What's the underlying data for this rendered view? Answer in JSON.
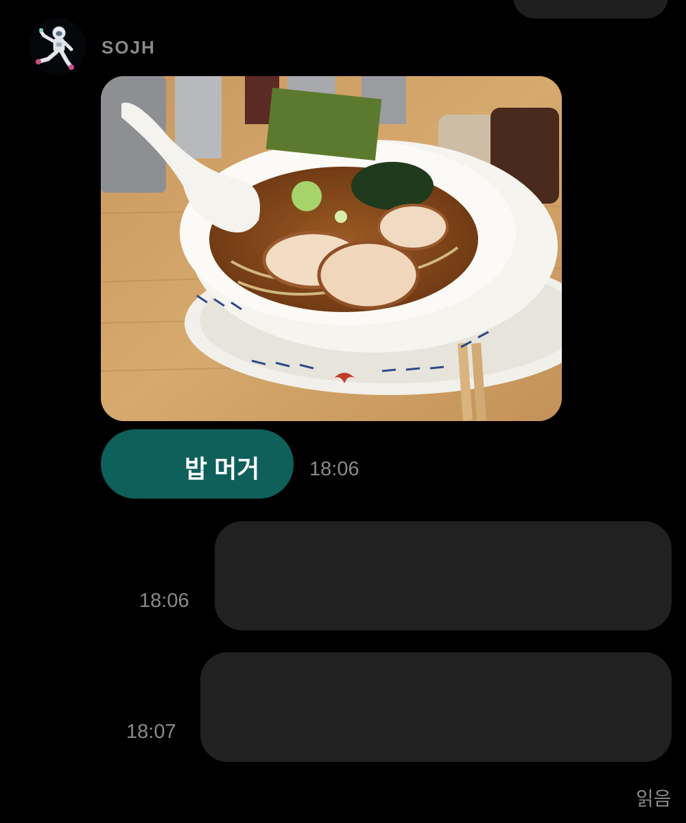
{
  "chat": {
    "sender_name": "SOJH",
    "received": {
      "photo_description": "Bowl of shoyu ramen with chashu pork, nori, wakame and green onion on a wooden table",
      "text": "밥 머거",
      "time": "18:06"
    },
    "sent": [
      {
        "time": "18:06",
        "text": ""
      },
      {
        "time": "18:07",
        "text": ""
      }
    ],
    "read_status": "읽음"
  },
  "colors": {
    "background": "#000000",
    "received_bubble": "#0f5f5b",
    "sent_bubble": "#212121",
    "secondary_text": "#8a8a8a"
  }
}
